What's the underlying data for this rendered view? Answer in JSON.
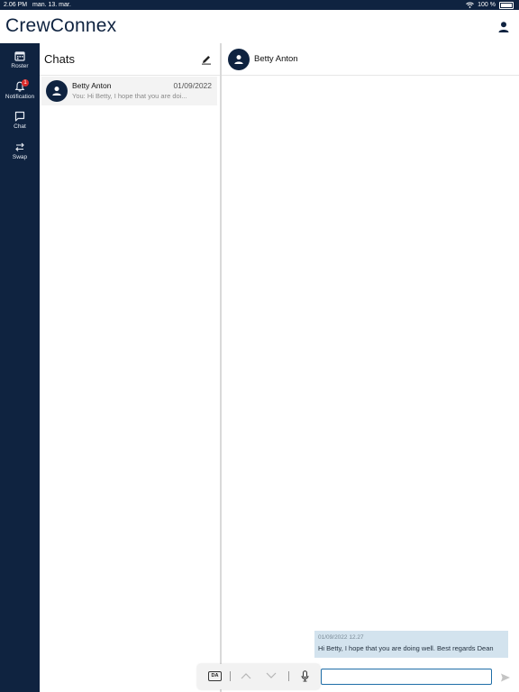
{
  "status_bar": {
    "time": "2.06 PM",
    "date": "man. 13. mar.",
    "battery": "100 %"
  },
  "app": {
    "title": "CrewConnex"
  },
  "nav": {
    "items": [
      {
        "label": "Roster",
        "icon": "calendar-icon"
      },
      {
        "label": "Notification",
        "icon": "bell-icon",
        "badge": "1"
      },
      {
        "label": "Chat",
        "icon": "chat-icon"
      },
      {
        "label": "Swap",
        "icon": "swap-icon"
      }
    ]
  },
  "chats": {
    "title": "Chats",
    "list": [
      {
        "name": "Betty Anton",
        "date": "01/09/2022",
        "preview": "You: Hi Betty, I hope that you are doi..."
      }
    ]
  },
  "conversation": {
    "contact_name": "Betty Anton",
    "messages": [
      {
        "timestamp": "01/09/2022 12.27",
        "text": "Hi Betty, I hope that you are doing well. Best regards Dean"
      }
    ],
    "input_value": ""
  },
  "keyboard_bar": {
    "language": "DA"
  },
  "colors": {
    "brand_navy": "#0f2340",
    "bubble": "#d3e3ee",
    "badge": "#d92b2b",
    "input_border": "#1f6ea8"
  }
}
